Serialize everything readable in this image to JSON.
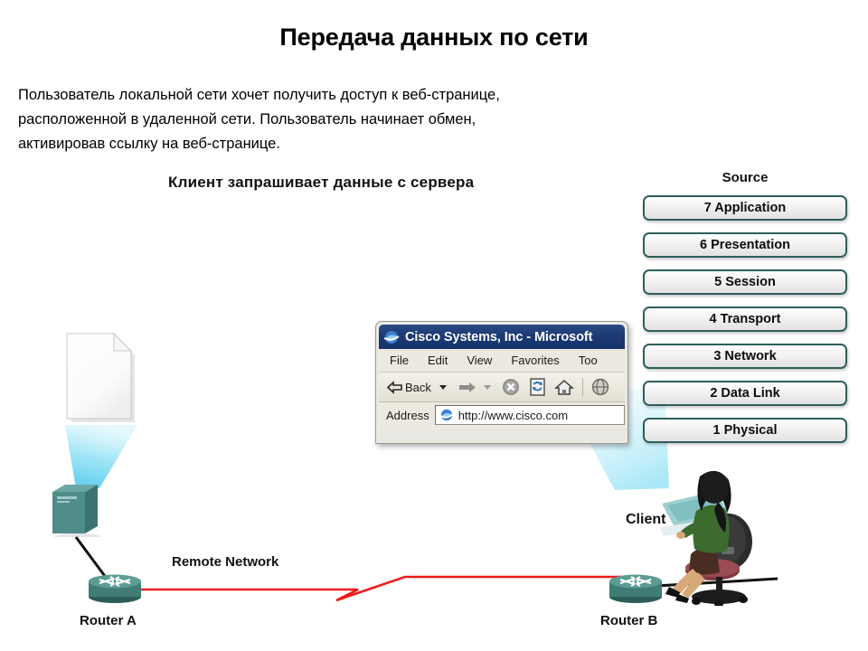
{
  "slide": {
    "title": "Передача данных по сети",
    "intro_lines": [
      "Пользователь локальной сети хочет получить доступ к веб-странице,",
      "расположенной в удаленной сети. Пользователь начинает обмен,",
      "активировав ссылку на веб-странице."
    ],
    "diagram_caption": "Клиент запрашивает данные с сервера"
  },
  "browser": {
    "title": "Cisco Systems, Inc - Microsoft",
    "menu": [
      "File",
      "Edit",
      "View",
      "Favorites",
      "Too"
    ],
    "toolbar": {
      "back_label": "Back",
      "back_icon": "back-arrow-icon",
      "back_dropdown_icon": "chevron-down-icon",
      "forward_icon": "forward-arrow-icon",
      "forward_dropdown_icon": "chevron-down-icon",
      "stop_icon": "stop-icon",
      "refresh_icon": "refresh-icon",
      "home_icon": "home-icon",
      "search_icon": "search-globe-icon"
    },
    "address": {
      "label": "Address",
      "icon": "internet-explorer-icon",
      "url": "http://www.cisco.com"
    },
    "window_icon": "internet-explorer-icon"
  },
  "osi": {
    "heading": "Source",
    "layers": [
      {
        "label": "7 Application"
      },
      {
        "label": "6 Presentation"
      },
      {
        "label": "5 Session"
      },
      {
        "label": "4 Transport"
      },
      {
        "label": "3 Network"
      },
      {
        "label": "2 Data Link"
      },
      {
        "label": "1 Physical"
      }
    ]
  },
  "network": {
    "router_a_label": "Router A",
    "router_b_label": "Router B",
    "remote_network_label": "Remote Network",
    "client_label": "Client",
    "server_icon": "server-tower-icon",
    "document_icon": "document-page-icon",
    "router_icon": "router-icon",
    "client_icon": "client-workstation-icon"
  },
  "colors": {
    "osi_border": "#2e5f5c",
    "beam": "#6fd6f2",
    "router_body": "#3f7d76",
    "server_body": "#5e9a97",
    "link_red": "#ee1c1c",
    "titlebar_blue": "#1d3a73",
    "text_black": "#000000"
  }
}
